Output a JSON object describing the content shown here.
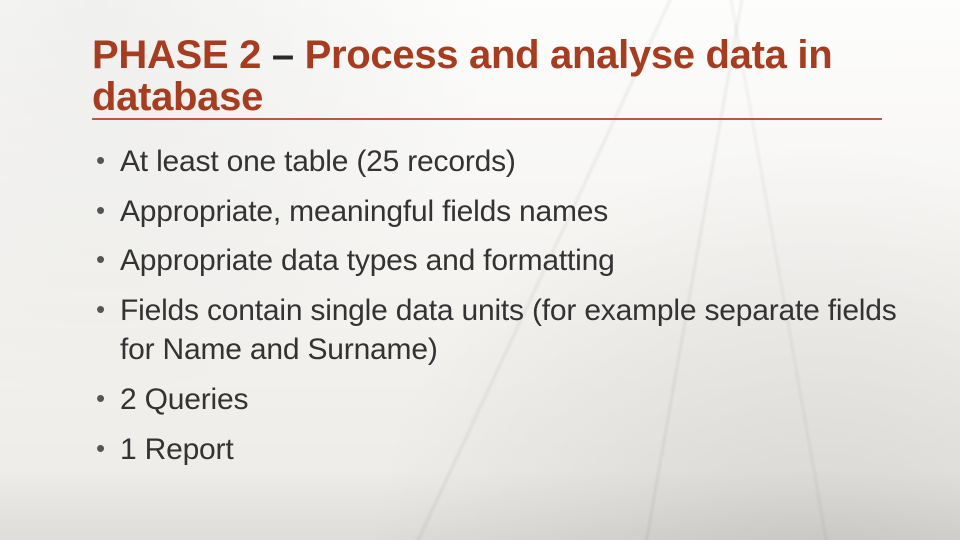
{
  "title": {
    "prefix": "PHASE 2",
    "separator": " – ",
    "rest": "Process and analyse data in database"
  },
  "bullets": [
    "At least one table (25 records)",
    "Appropriate, meaningful fields names",
    "Appropriate data types and formatting",
    "Fields contain single data units (for example separate fields for Name and Surname)",
    "2 Queries",
    "1 Report"
  ]
}
